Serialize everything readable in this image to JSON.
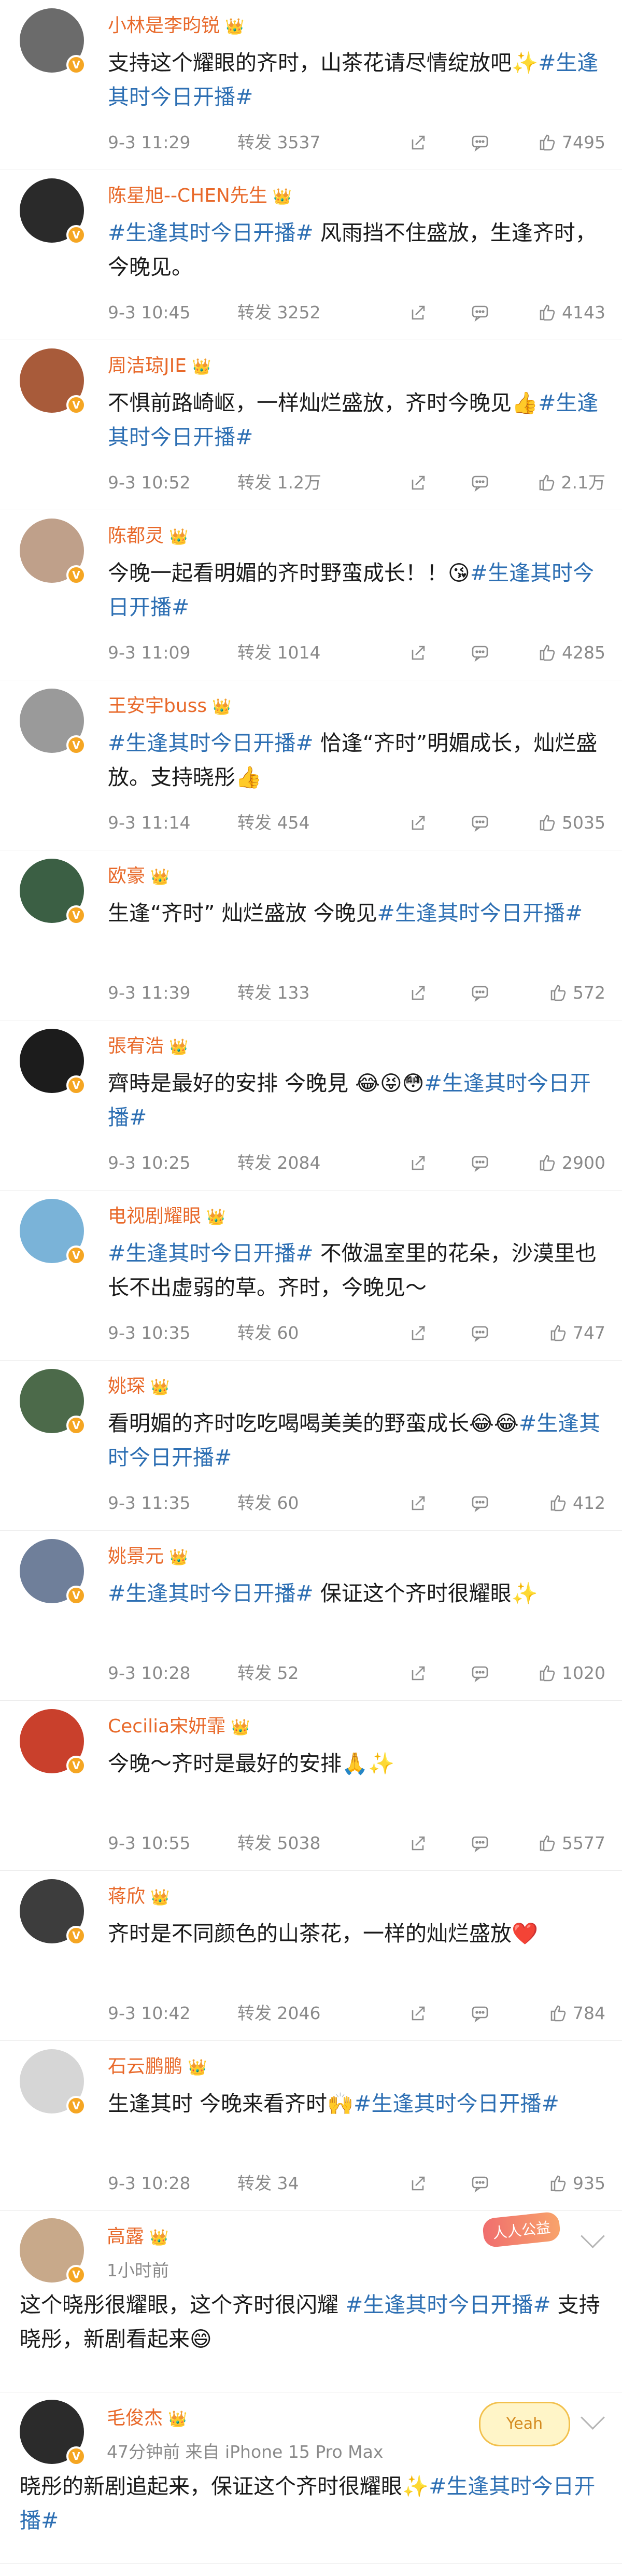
{
  "posts": [
    {
      "name": "小林是李昀锐",
      "text": "支持这个耀眼的齐时，山茶花请尽情绽放吧✨",
      "tag": "#生逢其时今日开播#",
      "after": "",
      "time": "9-3 11:29",
      "repost": "转发 3537",
      "likes": "7495",
      "avatar_color": "#6b6b6b"
    },
    {
      "name": "陈星旭--CHEN先生",
      "text": "",
      "tag": "#生逢其时今日开播#",
      "after": " 风雨挡不住盛放，生逢齐时，今晚见。",
      "time": "9-3 10:45",
      "repost": "转发 3252",
      "likes": "4143",
      "avatar_color": "#2a2a2a"
    },
    {
      "name": "周洁琼JIE",
      "text": "不惧前路崎岖，一样灿烂盛放，齐时今晚见👍",
      "tag": "#生逢其时今日开播#",
      "after": "",
      "time": "9-3 10:52",
      "repost": "转发 1.2万",
      "likes": "2.1万",
      "avatar_color": "#a85b3a"
    },
    {
      "name": "陈都灵",
      "text": "今晚一起看明媚的齐时野蛮成长！！😘",
      "tag": "#生逢其时今日开播#",
      "after": "",
      "time": "9-3 11:09",
      "repost": "转发 1014",
      "likes": "4285",
      "avatar_color": "#bfa08a"
    },
    {
      "name": "王安宇buss",
      "text": "",
      "tag": "#生逢其时今日开播#",
      "after": " 恰逢“齐时”明媚成长，灿烂盛放。支持晓彤👍",
      "time": "9-3 11:14",
      "repost": "转发 454",
      "likes": "5035",
      "avatar_color": "#9a9a9a"
    },
    {
      "name": "欧豪",
      "text": "生逢“齐时” 灿烂盛放 今晚见",
      "tag": "#生逢其时今日开播#",
      "after": "",
      "time": "9-3 11:39",
      "repost": "转发 133",
      "likes": "572",
      "avatar_color": "#3b5f44"
    },
    {
      "name": "張宥浩",
      "text": "齊時是最好的安排 今晚見 😂😝😳",
      "tag": "#生逢其时今日开播#",
      "after": "",
      "time": "9-3 10:25",
      "repost": "转发 2084",
      "likes": "2900",
      "avatar_color": "#1c1c1c"
    },
    {
      "name": "电视剧耀眼",
      "text": "",
      "tag": "#生逢其时今日开播#",
      "after": " 不做温室里的花朵，沙漠里也长不出虚弱的草。齐时，今晚见～",
      "time": "9-3 10:35",
      "repost": "转发 60",
      "likes": "747",
      "avatar_color": "#7ab3d8"
    },
    {
      "name": "姚琛",
      "text": "看明媚的齐时吃吃喝喝美美的野蛮成长😂😂",
      "tag": "#生逢其时今日开播#",
      "after": "",
      "time": "9-3 11:35",
      "repost": "转发 60",
      "likes": "412",
      "avatar_color": "#4c6a4a"
    },
    {
      "name": "姚景元",
      "text": "",
      "tag": "#生逢其时今日开播#",
      "after": " 保证这个齐时很耀眼✨",
      "time": "9-3 10:28",
      "repost": "转发 52",
      "likes": "1020",
      "avatar_color": "#6f7f9a"
    },
    {
      "name": "Cecilia宋妍霏",
      "text": "今晚～齐时是最好的安排🙏✨",
      "tag": "",
      "after": "",
      "time": "9-3 10:55",
      "repost": "转发 5038",
      "likes": "5577",
      "avatar_color": "#c9402c"
    },
    {
      "name": "蒋欣",
      "text": "齐时是不同颜色的山茶花，一样的灿烂盛放❤️",
      "tag": "",
      "after": "",
      "time": "9-3 10:42",
      "repost": "转发 2046",
      "likes": "784",
      "avatar_color": "#3d3d3d"
    },
    {
      "name": "石云鹏鹏",
      "text": "生逢其时 今晚来看齐时🙌",
      "tag": "#生逢其时今日开播#",
      "after": "",
      "time": "9-3 10:28",
      "repost": "转发 34",
      "likes": "935",
      "avatar_color": "#d6d6d6"
    }
  ],
  "extra": [
    {
      "name": "高露",
      "sub": "1小时前",
      "sticker": "人人公益",
      "text": "这个晓彤很耀眼，这个齐时很闪耀 ",
      "tag": "#生逢其时今日开播#",
      "after": " 支持晓彤，新剧看起来😄",
      "avatar_color": "#c8a98a"
    },
    {
      "name": "毛俊杰",
      "sub": "47分钟前  来自 iPhone 15 Pro Max",
      "sticker": "Yeah",
      "text": "晓彤的新剧追起来，保证这个齐时很耀眼✨",
      "tag": "#生逢其时今日开播#",
      "after": "",
      "avatar_color": "#2b2b2b"
    }
  ]
}
